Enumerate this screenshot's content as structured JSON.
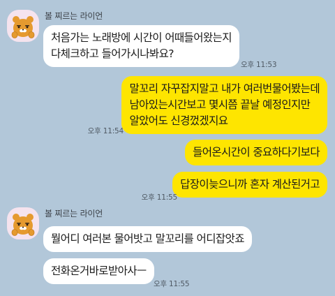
{
  "chat": {
    "groups": [
      {
        "sender": "볼 찌르는 라이언",
        "avatar_icon": "ryan-character-icon",
        "messages": [
          {
            "lines": [
              "처음가는 노래방에 시간이 어때들어왔는지",
              "다체크하고 들어가시나봐요?"
            ],
            "time": "오후 11:53"
          }
        ]
      },
      {
        "messages": [
          {
            "lines": [
              "말꼬리 자꾸잡지말고 내가 여러번물어봤는데",
              "남아있는시간보고 몇시쯤 끝날 예정인지만",
              "알았어도 신경껐겠지요"
            ],
            "time": "오후 11:54"
          },
          {
            "lines": [
              "들어온시간이 중요하다기보다"
            ]
          },
          {
            "lines": [
              "답장이늦으니까 혼자 계산된거고"
            ],
            "time": "오후 11:55"
          }
        ]
      },
      {
        "sender": "볼 찌르는 라이언",
        "avatar_icon": "ryan-character-icon",
        "messages": [
          {
            "lines": [
              "뭘어디 여러본 물어밧고 말꼬리를 어디잡앗죠"
            ]
          },
          {
            "lines": [
              "전화온거바로받아사ㅡ"
            ],
            "time": "오후 11:55"
          }
        ]
      }
    ]
  },
  "colors": {
    "background": "#b2c7d9",
    "incoming_bubble": "#ffffff",
    "outgoing_bubble": "#fee500",
    "avatar_background": "#f5e3ee",
    "ryan_face": "#e59a2f"
  }
}
